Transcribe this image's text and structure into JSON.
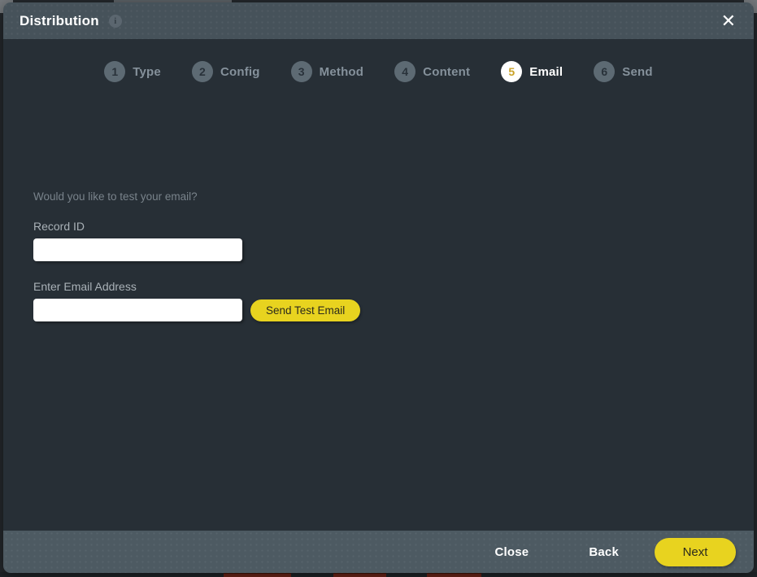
{
  "modal": {
    "title": "Distribution",
    "info_icon_glyph": "i",
    "close_icon_glyph": "✕"
  },
  "stepper": {
    "active_step": 5,
    "steps": [
      {
        "number": "1",
        "label": "Type"
      },
      {
        "number": "2",
        "label": "Config"
      },
      {
        "number": "3",
        "label": "Method"
      },
      {
        "number": "4",
        "label": "Content"
      },
      {
        "number": "5",
        "label": "Email"
      },
      {
        "number": "6",
        "label": "Send"
      }
    ]
  },
  "form": {
    "question": "Would you like to test your email?",
    "record_id": {
      "label": "Record ID",
      "value": "",
      "placeholder": ""
    },
    "email": {
      "label": "Enter Email Address",
      "value": "",
      "placeholder": ""
    },
    "send_test_button_label": "Send Test Email"
  },
  "footer": {
    "close_label": "Close",
    "back_label": "Back",
    "next_label": "Next"
  },
  "colors": {
    "accent_yellow": "#e8d31f",
    "active_step_number": "#c9a227",
    "header_bg": "#46525a",
    "footer_bg": "#4d5a62",
    "body_bg": "#272f36"
  }
}
